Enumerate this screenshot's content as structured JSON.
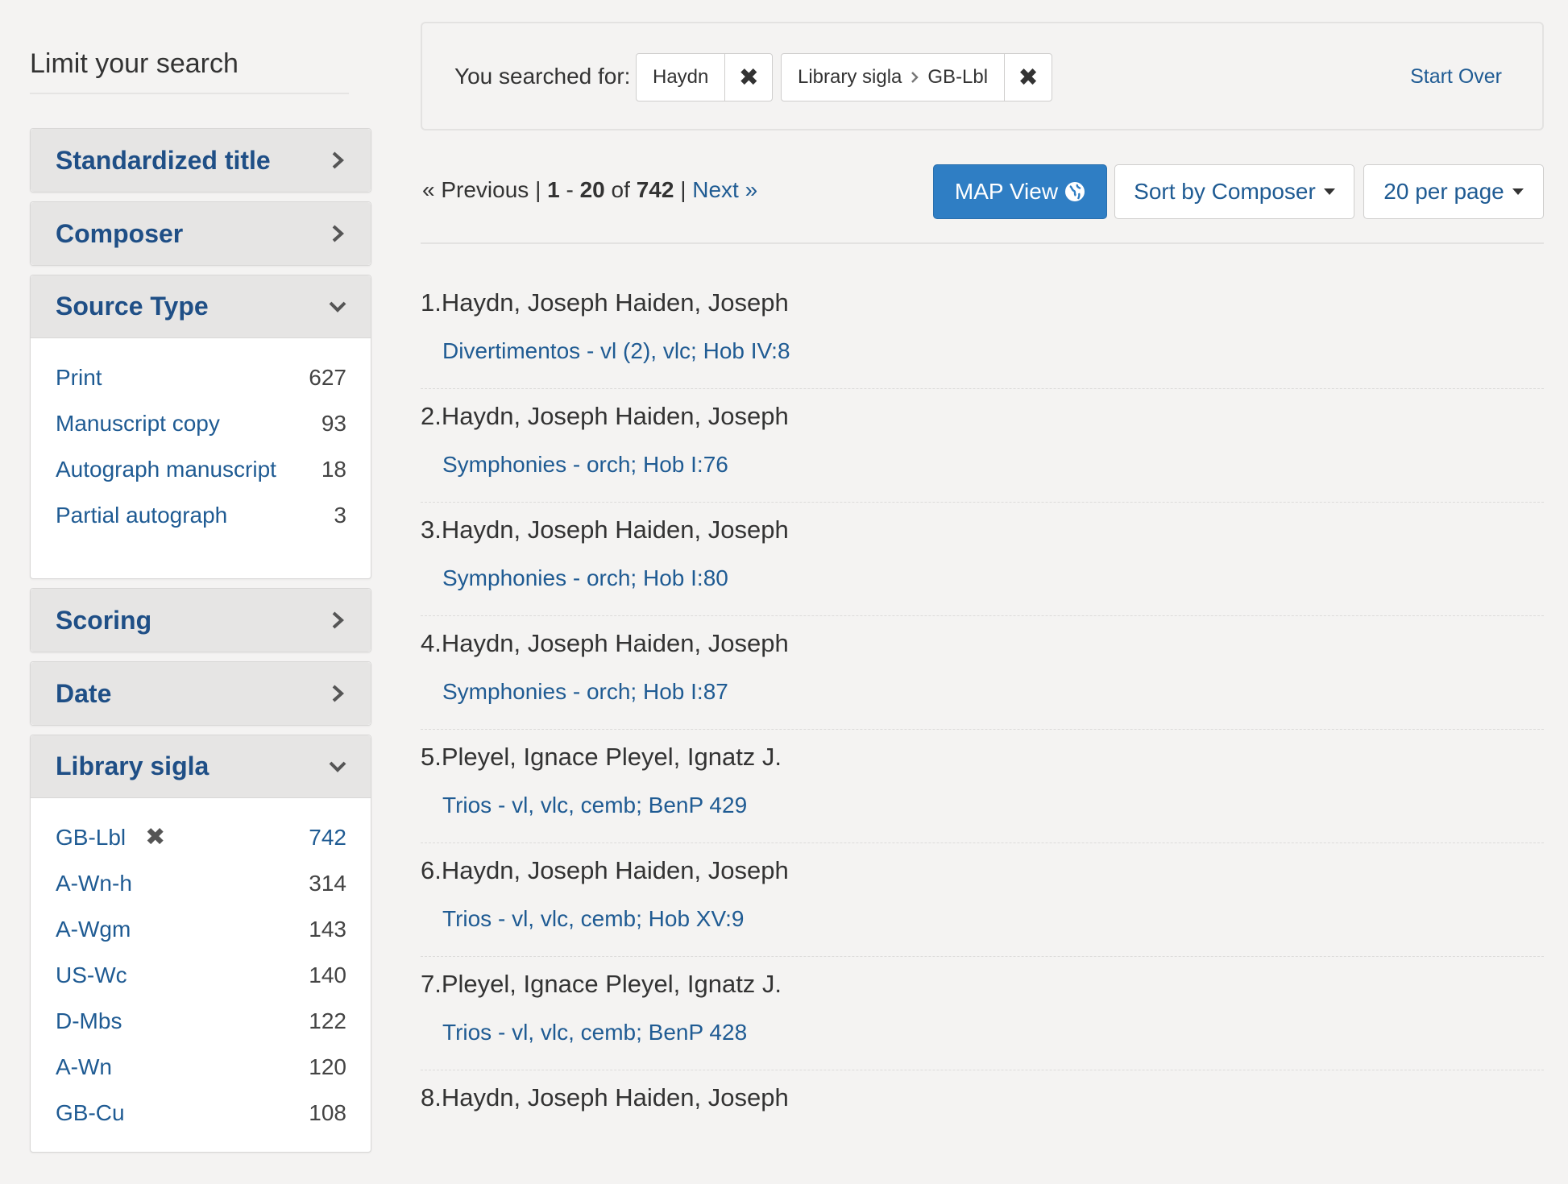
{
  "sidebar": {
    "heading": "Limit your search",
    "facets": [
      {
        "title": "Standardized title",
        "state": "collapsed"
      },
      {
        "title": "Composer",
        "state": "collapsed"
      },
      {
        "title": "Source Type",
        "state": "expanded",
        "items": [
          {
            "label": "Print",
            "count": "627"
          },
          {
            "label": "Manuscript copy",
            "count": "93"
          },
          {
            "label": "Autograph manuscript",
            "count": "18"
          },
          {
            "label": "Partial autograph",
            "count": "3"
          }
        ]
      },
      {
        "title": "Scoring",
        "state": "collapsed"
      },
      {
        "title": "Date",
        "state": "collapsed"
      },
      {
        "title": "Library sigla",
        "state": "expanded",
        "items": [
          {
            "label": "GB-Lbl",
            "count": "742",
            "selected": true
          },
          {
            "label": "A-Wn-h",
            "count": "314"
          },
          {
            "label": "A-Wgm",
            "count": "143"
          },
          {
            "label": "US-Wc",
            "count": "140"
          },
          {
            "label": "D-Mbs",
            "count": "122"
          },
          {
            "label": "A-Wn",
            "count": "120"
          },
          {
            "label": "GB-Cu",
            "count": "108"
          }
        ]
      }
    ]
  },
  "constraints": {
    "label": "You searched for:",
    "query": "Haydn",
    "filter_field": "Library sigla",
    "filter_value": "GB-Lbl",
    "start_over": "Start Over"
  },
  "pager": {
    "previous": "« Previous",
    "separator": "|",
    "start": "1",
    "dash": "-",
    "end": "20",
    "of": "of",
    "total": "742",
    "next": "Next »"
  },
  "tools": {
    "map_view": "MAP View",
    "sort": "Sort by Composer",
    "per_page": "20 per page"
  },
  "results": [
    {
      "number": "1.",
      "title": "Haydn, Joseph Haiden, Joseph",
      "link": "Divertimentos - vl (2), vlc; Hob IV:8"
    },
    {
      "number": "2.",
      "title": "Haydn, Joseph Haiden, Joseph",
      "link": "Symphonies - orch; Hob I:76"
    },
    {
      "number": "3.",
      "title": "Haydn, Joseph Haiden, Joseph",
      "link": "Symphonies - orch; Hob I:80"
    },
    {
      "number": "4.",
      "title": "Haydn, Joseph Haiden, Joseph",
      "link": "Symphonies - orch; Hob I:87"
    },
    {
      "number": "5.",
      "title": "Pleyel, Ignace Pleyel, Ignatz J.",
      "link": "Trios - vl, vlc, cemb; BenP 429"
    },
    {
      "number": "6.",
      "title": "Haydn, Joseph Haiden, Joseph",
      "link": "Trios - vl, vlc, cemb; Hob XV:9"
    },
    {
      "number": "7.",
      "title": "Pleyel, Ignace Pleyel, Ignatz J.",
      "link": "Trios - vl, vlc, cemb; BenP 428"
    },
    {
      "number": "8.",
      "title": "Haydn, Joseph Haiden, Joseph",
      "link": ""
    }
  ],
  "colors": {
    "accent": "#1f5b93",
    "facet_title": "#1f4f86",
    "primary_button": "#2f7ec4",
    "page_bg": "#f4f3f2"
  },
  "icons": {
    "facet_collapsed": "chevron-right-icon",
    "facet_expanded": "chevron-down-icon",
    "remove": "close-icon",
    "map": "globe-icon"
  }
}
